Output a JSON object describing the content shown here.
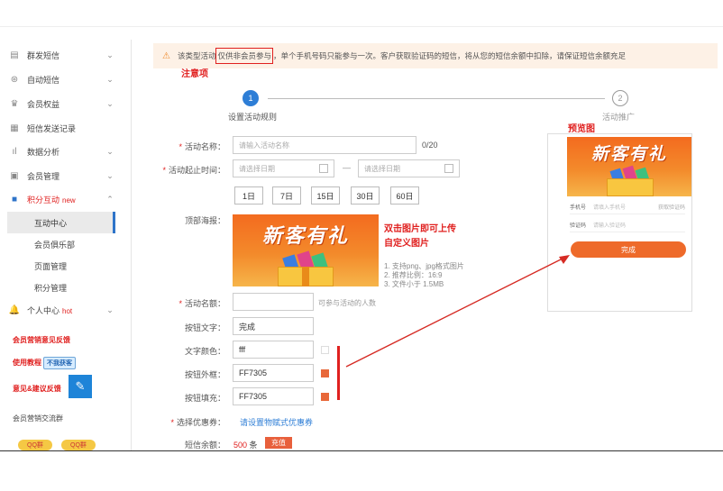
{
  "sidebar": {
    "items": [
      {
        "label": "群发短信",
        "icon": "mail-icon",
        "chev": "⌄"
      },
      {
        "label": "自动短信",
        "icon": "auto-icon",
        "chev": "⌄"
      },
      {
        "label": "会员权益",
        "icon": "crown-icon",
        "chev": "⌄"
      },
      {
        "label": "短信发送记录",
        "icon": "record-icon",
        "chev": ""
      },
      {
        "label": "数据分析",
        "icon": "chart-icon",
        "chev": "⌄"
      },
      {
        "label": "会员管理",
        "icon": "member-icon",
        "chev": "⌄"
      },
      {
        "label": "积分互动",
        "tag": "new",
        "icon": "points-icon",
        "chev": "⌃"
      },
      {
        "label": "个人中心",
        "tag": "hot",
        "icon": "bell-icon",
        "chev": "⌄"
      }
    ],
    "sub_items": [
      "互动中心",
      "会员俱乐部",
      "页面管理",
      "积分管理"
    ],
    "feedback_label": "会员营销意见反馈",
    "tutorial_label": "使用教程",
    "tutorial_badge": "不我获客",
    "suggest_label": "意见&建议反馈",
    "group_label": "会员营销交流群",
    "qq_badges": [
      "QQ群",
      "QQ群"
    ]
  },
  "notice": {
    "prefix": "该类型活动",
    "highlight": "仅供非会员参与",
    "suffix": "，单个手机号码只能参与一次。客户获取验证码的短信，将从您的短信余额中扣除，请保证短信余额充足"
  },
  "annotations": {
    "note": "注意项",
    "preview": "预览图",
    "upload_line1": "双击图片即可上传",
    "upload_line2": "自定义图片"
  },
  "steps": [
    {
      "num": "1",
      "label": "设置活动规则"
    },
    {
      "num": "2",
      "label": "活动推广"
    }
  ],
  "form": {
    "name_label": "活动名称：",
    "name_placeholder": "请输入活动名称",
    "name_count": "0/20",
    "time_label": "活动起止时间：",
    "date_placeholder_start": "请选择日期",
    "date_separator": "—",
    "date_placeholder_end": "请选择日期",
    "day_buttons": [
      "1日",
      "7日",
      "15日",
      "30日",
      "60日"
    ],
    "poster_label": "顶部海报：",
    "banner_text": "新客有礼",
    "hints": [
      "1. 支持png、jpg格式图片",
      "2. 推荐比例：16:9",
      "3. 文件小于 1.5MB"
    ],
    "quota_label": "活动名额：",
    "quota_hint": "可参与活动的人数",
    "btn_text_label": "按钮文字：",
    "btn_text_value": "完成",
    "text_color_label": "文字颜色：",
    "text_color_value": "fff",
    "btn_border_label": "按钮外框：",
    "btn_border_value": "FF7305",
    "btn_fill_label": "按钮填充：",
    "btn_fill_value": "FF7305",
    "coupon_label": "选择优惠券：",
    "coupon_link": "请设置物赋式优惠券",
    "balance_label": "短信余额：",
    "balance_value": "500",
    "balance_unit": "条",
    "recharge_label": "充值"
  },
  "preview": {
    "banner_text": "新客有礼",
    "phone_label": "手机号",
    "phone_placeholder": "请填入手机号",
    "get_code": "获取验证码",
    "code_label": "验证码",
    "code_placeholder": "请输入验证码",
    "done_button": "完成"
  },
  "colors": {
    "accent_blue": "#2e7ed6",
    "orange": "#FF7305",
    "red_annotation": "#e0201f"
  }
}
